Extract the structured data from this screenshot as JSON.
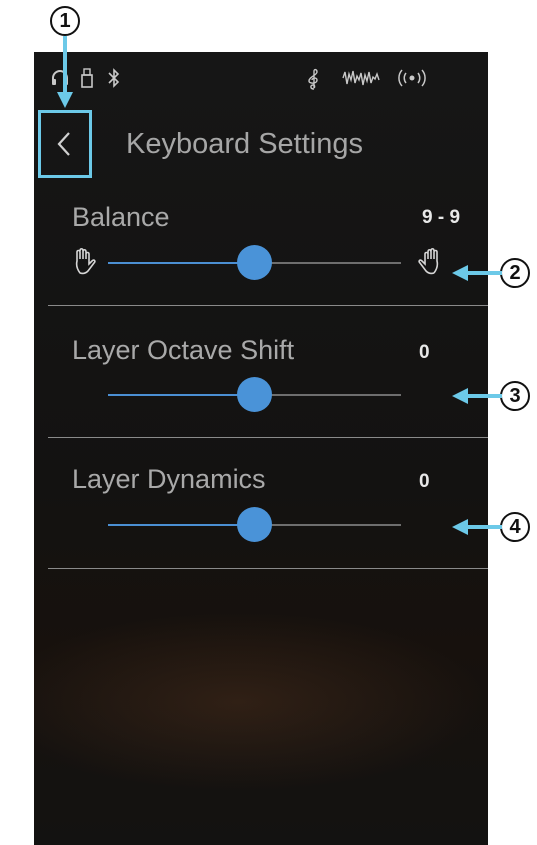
{
  "status_bar": {
    "icons": [
      "headphones-icon",
      "usb-drive-icon",
      "bluetooth-icon",
      "treble-clef-icon",
      "waveform-icon",
      "wireless-icon"
    ]
  },
  "header": {
    "title": "Keyboard Settings",
    "back_icon": "chevron-left-icon"
  },
  "settings": [
    {
      "label": "Balance",
      "value": "9 - 9",
      "slider_fraction": 0.5,
      "left_icon": "hand-left-icon",
      "right_icon": "hand-right-icon"
    },
    {
      "label": "Layer Octave Shift",
      "value": "0",
      "slider_fraction": 0.5
    },
    {
      "label": "Layer Dynamics",
      "value": "0",
      "slider_fraction": 0.5
    }
  ],
  "callouts": [
    "1",
    "2",
    "3",
    "4"
  ],
  "colors": {
    "accent": "#4a93d8",
    "highlight": "#6cc9e8",
    "background": "#141414"
  }
}
